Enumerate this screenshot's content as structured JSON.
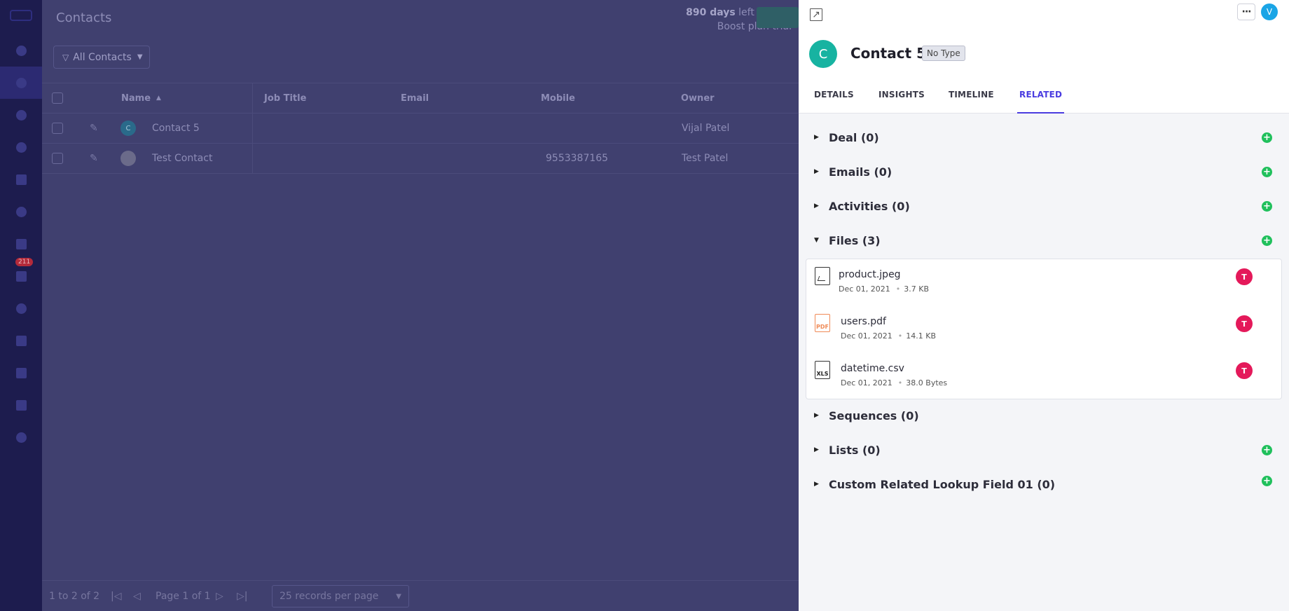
{
  "app": {
    "page_title": "Contacts",
    "trial": {
      "days": "890 days",
      "text1": " left in your",
      "text2": "Boost plan trial"
    },
    "unread_badge": "211"
  },
  "toolbar": {
    "filter_label": "All Contacts"
  },
  "table": {
    "headers": {
      "name": "Name",
      "job_title": "Job Title",
      "email": "Email",
      "mobile": "Mobile",
      "owner": "Owner"
    },
    "rows": [
      {
        "avatar": "C",
        "name": "Contact 5",
        "mobile": "",
        "owner": "Vijal Patel"
      },
      {
        "avatar": "",
        "name": "Test Contact",
        "mobile": "9553387165",
        "owner": "Test Patel"
      }
    ]
  },
  "pagination": {
    "range": "1 to 2 of 2",
    "page": "Page 1 of 1",
    "per_page": "25 records per page"
  },
  "drawer": {
    "user_initial": "V",
    "contact": {
      "initial": "C",
      "name": "Contact 5",
      "type": "No Type"
    },
    "tabs": [
      "DETAILS",
      "INSIGHTS",
      "TIMELINE",
      "RELATED"
    ],
    "active_tab": "RELATED",
    "sections": [
      {
        "label": "Deal (0)",
        "expanded": false,
        "addable": true
      },
      {
        "label": "Emails (0)",
        "expanded": false,
        "addable": true
      },
      {
        "label": "Activities (0)",
        "expanded": false,
        "addable": true
      },
      {
        "label": "Files (3)",
        "expanded": true,
        "addable": true
      },
      {
        "label": "Sequences (0)",
        "expanded": false,
        "addable": false
      },
      {
        "label": "Lists (0)",
        "expanded": false,
        "addable": true
      },
      {
        "label": "Custom Related Lookup Field 01  (0)",
        "expanded": false,
        "addable": true
      }
    ],
    "files": [
      {
        "name": "product.jpeg",
        "date": "Dec 01, 2021",
        "size": "3.7 KB",
        "icon": "image-file-icon",
        "owner": "T"
      },
      {
        "name": "users.pdf",
        "date": "Dec 01, 2021",
        "size": "14.1 KB",
        "icon": "pdf-file-icon",
        "icon_text": "PDF",
        "owner": "T"
      },
      {
        "name": "datetime.csv",
        "date": "Dec 01, 2021",
        "size": "38.0 Bytes",
        "icon": "xls-file-icon",
        "icon_text": "XLS",
        "owner": "T"
      }
    ]
  },
  "colors": {
    "accent": "#4a3ce0",
    "add": "#20c05c",
    "owner_avatar": "#e4195a",
    "contact_avatar": "#17b3a1",
    "user_avatar": "#1aa5e6"
  }
}
